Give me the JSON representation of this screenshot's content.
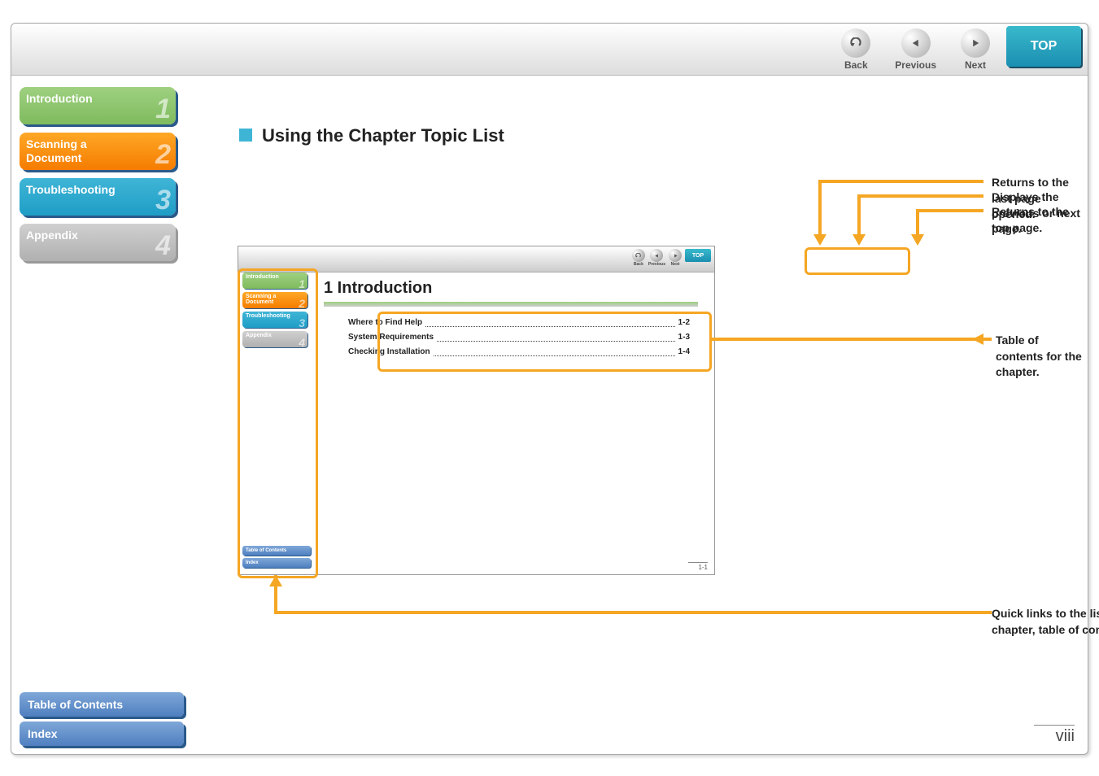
{
  "topnav": {
    "back": "Back",
    "previous": "Previous",
    "next": "Next",
    "top": "TOP"
  },
  "sidebar": [
    {
      "label": "Introduction",
      "num": "1"
    },
    {
      "label": "Scanning a\nDocument",
      "num": "2"
    },
    {
      "label": "Troubleshooting",
      "num": "3"
    },
    {
      "label": "Appendix",
      "num": "4"
    }
  ],
  "bottomlinks": {
    "toc": "Table of Contents",
    "index": "Index"
  },
  "section_title": "Using the Chapter Topic List",
  "mini": {
    "topnav": {
      "back": "Back",
      "previous": "Previous",
      "next": "Next",
      "top": "TOP"
    },
    "sidebar": [
      {
        "label": "Introduction",
        "num": "1"
      },
      {
        "label": "Scanning a\nDocument",
        "num": "2"
      },
      {
        "label": "Troubleshooting",
        "num": "3"
      },
      {
        "label": "Appendix",
        "num": "4"
      }
    ],
    "bottomlinks": {
      "toc": "Table of Contents",
      "index": "Index"
    },
    "title": "1  Introduction",
    "toc": [
      {
        "label": "Where to Find Help",
        "page": "1-2"
      },
      {
        "label": "System Requirements",
        "page": "1-3"
      },
      {
        "label": "Checking Installation",
        "page": "1-4"
      }
    ],
    "pgnum": "1-1"
  },
  "annotations": {
    "back_desc": "Returns to the last page opened.",
    "prevnext_desc": "Displays the previous or next page.",
    "top_desc": "Returns to the top page.",
    "toc_callout": "Table of contents for the chapter.",
    "quicklinks_callout": "Quick links to the list of things you can do, topics for each chapter, table of contents, and the index."
  },
  "page_number": "viii"
}
